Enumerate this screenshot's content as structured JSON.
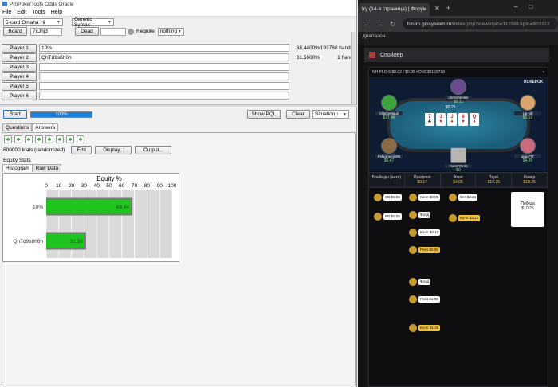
{
  "app": {
    "title": "ProPokerTools Odds Oracle",
    "menu": [
      "File",
      "Edit",
      "Tools",
      "Help"
    ],
    "game_select": "5-card Omaha Hi",
    "syntax_select": "Generic Syntax",
    "board_button": "Board",
    "board_value": "7cJhjd",
    "dead_button": "Dead",
    "dead_value": "",
    "require_label": "Require",
    "require_select": "nothing",
    "players": [
      {
        "label": "Player 1",
        "hand": "10%",
        "equity": "68,4400%",
        "hands": "193760 hands"
      },
      {
        "label": "Player 2",
        "hand": "QhTd9s8h6h",
        "equity": "31,5600%",
        "hands": "1 hand"
      },
      {
        "label": "Player 3",
        "hand": "",
        "equity": "",
        "hands": ""
      },
      {
        "label": "Player 4",
        "hand": "",
        "equity": "",
        "hands": ""
      },
      {
        "label": "Player 5",
        "hand": "",
        "equity": "",
        "hands": ""
      },
      {
        "label": "Player 6",
        "hand": "",
        "equity": "",
        "hands": ""
      }
    ],
    "start_button": "Start",
    "progress": {
      "percent": 100,
      "label": "100%"
    },
    "show_pql_button": "Show PQL",
    "clear_button": "Clear",
    "situation_select": "Situation ↑",
    "tabs": {
      "questions": "Questions",
      "answers": "Answers"
    },
    "club_buttons": 8,
    "trials_label": "600000 trials (randomized)",
    "edit_button": "Edit",
    "display_button": "Display...",
    "output_button": "Output...",
    "equity_stats_label": "Equity Stats",
    "subtabs": {
      "histogram": "Histogram",
      "raw": "Raw Data"
    }
  },
  "chart_data": {
    "type": "bar",
    "orientation": "horizontal",
    "title": "Equity %",
    "categories": [
      "10%",
      "QhTd9s8h6h"
    ],
    "values": [
      68.44,
      31.56
    ],
    "value_labels": [
      "68,44",
      "31,56"
    ],
    "xlim": [
      0,
      100
    ],
    "xticks": [
      0,
      10,
      20,
      30,
      40,
      50,
      60,
      70,
      80,
      90,
      100
    ],
    "bar_color": "#1fc41f",
    "grid": true
  },
  "browser": {
    "tab_title": "try (14-я страница) | Форум",
    "url_host": "forum.gipsyteam.ru",
    "url_rest": "/index.php?viewtopic=112581&pid=803112",
    "forum_snippet": "диапазон...",
    "spoiler_label": "Спойлер",
    "hand_header": "NH PLO-5 $0.02 / $0.05 #OM230160718",
    "brand": "ПОКЕРОК",
    "pot": "$0.25",
    "board_cards": [
      {
        "rank": "7",
        "suit": "♣",
        "color": "blk"
      },
      {
        "rank": "J",
        "suit": "♥",
        "color": "red"
      },
      {
        "rank": "J",
        "suit": "♦",
        "color": "red"
      },
      {
        "rank": "8",
        "suit": "♥",
        "color": "red"
      },
      {
        "rank": "Q",
        "suit": "♦",
        "color": "red"
      }
    ],
    "seats": [
      {
        "name": "chenshimeik",
        "stack": "$0.11"
      },
      {
        "name": "AlfaCentauri",
        "stack": "$37.44"
      },
      {
        "name": "Up-hill",
        "stack": "$5.53"
      },
      {
        "name": "Polkorovnik96",
        "stack": "$6.47"
      },
      {
        "name": "guju777",
        "stack": "$4.89"
      },
      {
        "name": "HeroFOHO",
        "stack": "$0"
      }
    ],
    "streets": [
      {
        "name": "Блайнды (анте)",
        "amount": ""
      },
      {
        "name": "Префлоп",
        "amount": "$0.17"
      },
      {
        "name": "Флоп",
        "amount": "$4.05"
      },
      {
        "name": "Терн",
        "amount": "$10.25"
      },
      {
        "name": "Ривер",
        "amount": "$10.25"
      }
    ],
    "actions": [
      {
        "text": "SB $0.02",
        "gold": false
      },
      {
        "text": "BB $0.05",
        "gold": false
      },
      {
        "text": "Колл $0.08",
        "gold": false
      },
      {
        "text": "Фолд",
        "gold": false
      },
      {
        "text": "Колл $0.10",
        "gold": false
      },
      {
        "text": "Рейз $0.55",
        "gold": true
      },
      {
        "text": "Бет $3.21",
        "gold": false
      },
      {
        "text": "Колл $3.10",
        "gold": true
      },
      {
        "text": "Фолд",
        "gold": false
      },
      {
        "text": "Рейз $1.90",
        "gold": false
      },
      {
        "text": "Колл $1.35",
        "gold": true
      }
    ],
    "win_box": {
      "label": "Победа",
      "amount": "$10.25"
    }
  }
}
